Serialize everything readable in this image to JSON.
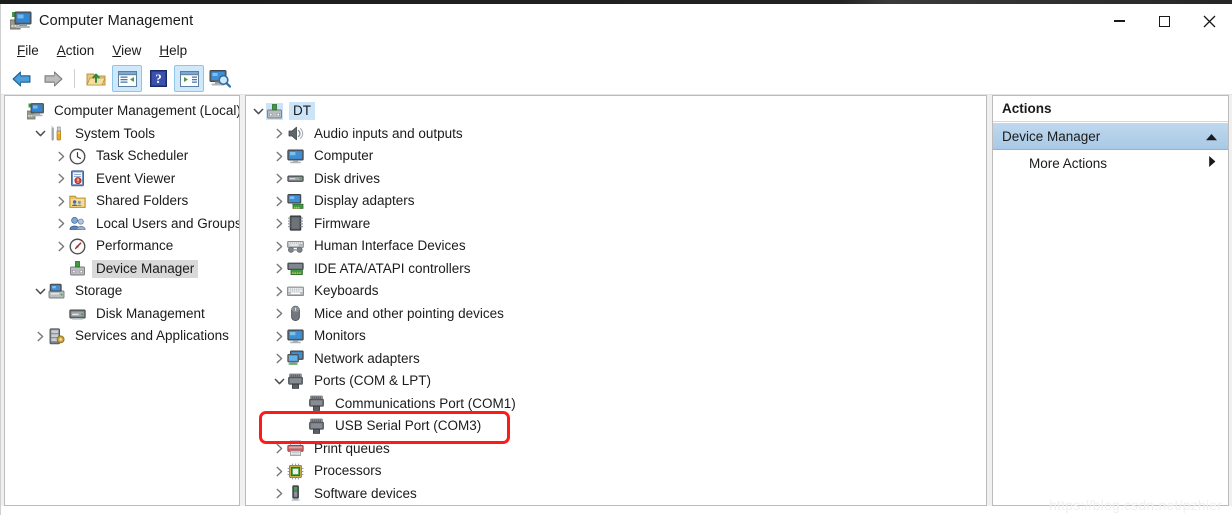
{
  "window": {
    "title": "Computer Management",
    "icon": "computer-management-icon",
    "controls": {
      "minimize": "Minimize",
      "maximize": "Maximize",
      "close": "Close"
    }
  },
  "menubar": {
    "items": [
      {
        "label": "File",
        "accel": "F"
      },
      {
        "label": "Action",
        "accel": "A"
      },
      {
        "label": "View",
        "accel": "V"
      },
      {
        "label": "Help",
        "accel": "H"
      }
    ]
  },
  "toolbar": {
    "buttons": [
      {
        "name": "back-button",
        "icon": "back-arrow-icon",
        "state": "normal"
      },
      {
        "name": "forward-button",
        "icon": "forward-arrow-icon",
        "state": "disabled"
      },
      {
        "name": "up-one-level-button",
        "icon": "folder-up-icon",
        "state": "normal"
      },
      {
        "name": "show-hide-tree-button",
        "icon": "console-tree-icon",
        "state": "active"
      },
      {
        "name": "help-button",
        "icon": "question-mark-icon",
        "state": "normal"
      },
      {
        "name": "show-hide-action-pane-button",
        "icon": "action-pane-icon",
        "state": "active"
      },
      {
        "name": "scan-hardware-button",
        "icon": "monitor-search-icon",
        "state": "normal"
      }
    ]
  },
  "sidebar": {
    "items": [
      {
        "label": "Computer Management (Local)",
        "icon": "computer-management-icon",
        "indent": 0,
        "twisty": "none",
        "selected": "none"
      },
      {
        "label": "System Tools",
        "icon": "system-tools-icon",
        "indent": 1,
        "twisty": "expanded",
        "selected": "none"
      },
      {
        "label": "Task Scheduler",
        "icon": "clock-icon",
        "indent": 2,
        "twisty": "collapsed",
        "selected": "none"
      },
      {
        "label": "Event Viewer",
        "icon": "event-viewer-icon",
        "indent": 2,
        "twisty": "collapsed",
        "selected": "none"
      },
      {
        "label": "Shared Folders",
        "icon": "shared-folders-icon",
        "indent": 2,
        "twisty": "collapsed",
        "selected": "none"
      },
      {
        "label": "Local Users and Groups",
        "icon": "users-groups-icon",
        "indent": 2,
        "twisty": "collapsed",
        "selected": "none"
      },
      {
        "label": "Performance",
        "icon": "performance-icon",
        "indent": 2,
        "twisty": "collapsed",
        "selected": "none"
      },
      {
        "label": "Device Manager",
        "icon": "device-manager-icon",
        "indent": 2,
        "twisty": "none",
        "selected": "gray"
      },
      {
        "label": "Storage",
        "icon": "storage-icon",
        "indent": 1,
        "twisty": "expanded",
        "selected": "none"
      },
      {
        "label": "Disk Management",
        "icon": "disk-management-icon",
        "indent": 2,
        "twisty": "none",
        "selected": "none"
      },
      {
        "label": "Services and Applications",
        "icon": "services-icon",
        "indent": 1,
        "twisty": "collapsed",
        "selected": "none"
      }
    ]
  },
  "device_tree": {
    "items": [
      {
        "label": "DT",
        "icon": "computer-node-icon",
        "indent": 0,
        "twisty": "expanded",
        "selected": "blue"
      },
      {
        "label": "Audio inputs and outputs",
        "icon": "speaker-icon",
        "indent": 1,
        "twisty": "collapsed",
        "selected": "none"
      },
      {
        "label": "Computer",
        "icon": "monitor-icon",
        "indent": 1,
        "twisty": "collapsed",
        "selected": "none"
      },
      {
        "label": "Disk drives",
        "icon": "disk-drive-icon",
        "indent": 1,
        "twisty": "collapsed",
        "selected": "none"
      },
      {
        "label": "Display adapters",
        "icon": "display-adapter-icon",
        "indent": 1,
        "twisty": "collapsed",
        "selected": "none"
      },
      {
        "label": "Firmware",
        "icon": "firmware-chip-icon",
        "indent": 1,
        "twisty": "collapsed",
        "selected": "none"
      },
      {
        "label": "Human Interface Devices",
        "icon": "hid-icon",
        "indent": 1,
        "twisty": "collapsed",
        "selected": "none"
      },
      {
        "label": "IDE ATA/ATAPI controllers",
        "icon": "ide-controller-icon",
        "indent": 1,
        "twisty": "collapsed",
        "selected": "none"
      },
      {
        "label": "Keyboards",
        "icon": "keyboard-icon",
        "indent": 1,
        "twisty": "collapsed",
        "selected": "none"
      },
      {
        "label": "Mice and other pointing devices",
        "icon": "mouse-icon",
        "indent": 1,
        "twisty": "collapsed",
        "selected": "none"
      },
      {
        "label": "Monitors",
        "icon": "monitor-icon",
        "indent": 1,
        "twisty": "collapsed",
        "selected": "none"
      },
      {
        "label": "Network adapters",
        "icon": "network-adapter-icon",
        "indent": 1,
        "twisty": "collapsed",
        "selected": "none"
      },
      {
        "label": "Ports (COM & LPT)",
        "icon": "port-icon",
        "indent": 1,
        "twisty": "expanded",
        "selected": "none"
      },
      {
        "label": "Communications Port (COM1)",
        "icon": "port-icon",
        "indent": 2,
        "twisty": "none",
        "selected": "none"
      },
      {
        "label": "USB Serial Port (COM3)",
        "icon": "port-icon",
        "indent": 2,
        "twisty": "none",
        "selected": "none",
        "highlighted": true
      },
      {
        "label": "Print queues",
        "icon": "printer-icon",
        "indent": 1,
        "twisty": "collapsed",
        "selected": "none"
      },
      {
        "label": "Processors",
        "icon": "processor-icon",
        "indent": 1,
        "twisty": "collapsed",
        "selected": "none"
      },
      {
        "label": "Software devices",
        "icon": "software-device-icon",
        "indent": 1,
        "twisty": "collapsed",
        "selected": "none"
      }
    ]
  },
  "actions_pane": {
    "header": "Actions",
    "selected_item": {
      "label": "Device Manager",
      "icon": "chevron-up-icon"
    },
    "items": [
      {
        "label": "More Actions",
        "icon": "chevron-right-icon"
      }
    ]
  },
  "annotation": {
    "target": "USB Serial Port (COM3)",
    "color": "#ff1a1a"
  },
  "watermark": {
    "text": "https://blog.csdn.net/pzhier"
  }
}
